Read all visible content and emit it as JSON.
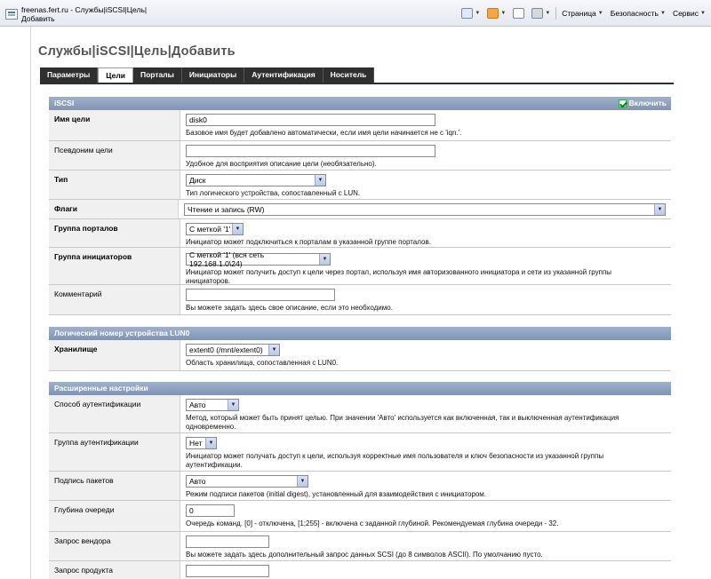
{
  "browser": {
    "tab_title": "freenas.fert.ru - Службы|iSCSI|Цель|Добавить",
    "page_label": "Страница",
    "security_label": "Безопасность",
    "service_label": "Сервис"
  },
  "page": {
    "title": "Службы|iSCSI|Цель|Добавить"
  },
  "nav": {
    "tabs": [
      "Параметры",
      "Цели",
      "Порталы",
      "Инициаторы",
      "Аутентификация",
      "Носитель"
    ],
    "active": "Цели"
  },
  "sections": {
    "iscsi": {
      "title": "iSCSI",
      "enable_label": "Включить"
    },
    "lun": {
      "title": "Логический номер устройства LUN0"
    },
    "advanced": {
      "title": "Расширенные настройки"
    }
  },
  "fields": {
    "target_name": {
      "label": "Имя цели",
      "value": "disk0",
      "help": "Базовое имя будет добавлено автоматически, если имя цели начинается не с 'iqn.'."
    },
    "alias": {
      "label": "Псевдоним цели",
      "value": "",
      "help": "Удобное для восприятия описание цели (необязательно)."
    },
    "type": {
      "label": "Тип",
      "value": "Диск",
      "help": "Тип логического устройства, сопоставленный с LUN."
    },
    "flags": {
      "label": "Флаги",
      "value": "Чтение и запись (RW)"
    },
    "portal_group": {
      "label": "Группа порталов",
      "value": "С меткой '1'",
      "help": "Инициатор может подключиться к порталам в указанной группе порталов."
    },
    "initiator_group": {
      "label": "Группа инициаторов",
      "value": "С меткой '1' (вся сеть 192.168.1.0\\24)",
      "help": "Инициатор может получить доступ к цели через портал, используя имя авторизованного инициатора и сети из указанной группы инициаторов."
    },
    "comment": {
      "label": "Комментарий",
      "value": "",
      "help": "Вы можете задать здесь свое описание, если это необходимо."
    },
    "storage": {
      "label": "Хранилище",
      "value": "extent0 (/mnt/extent0)",
      "help": "Область хранилища, сопоставленная с LUN0."
    },
    "auth_method": {
      "label": "Способ аутентификации",
      "value": "Авто",
      "help": "Метод, который может быть принят целью. При значении 'Авто' используется как включенная, так и выключенная аутентификация одновременно."
    },
    "auth_group": {
      "label": "Группа аутентификации",
      "value": "Нет",
      "help": "Инициатор может получать доступ к цели, используя корректные имя пользователя и ключ безопасности из указанной группы аутентификации."
    },
    "digest": {
      "label": "Подпись пакетов",
      "value": "Авто",
      "help": "Режим подписи пакетов (initial digest), установленный для взаимодействия с инициатором."
    },
    "queue_depth": {
      "label": "Глубина очереди",
      "value": "0",
      "help": "Очередь команд. [0] - отключена, [1;255] - включена с заданной глубиной. Рекомендуемая глубина очереди - 32."
    },
    "vendor_inquiry": {
      "label": "Запрос вендора",
      "value": "",
      "help": "Вы можете задать здесь дополнительный запрос данных SCSI (до 8 символов ASCII). По умолчанию пусто."
    },
    "product_inquiry": {
      "label": "Запрос продукта",
      "value": ""
    }
  }
}
